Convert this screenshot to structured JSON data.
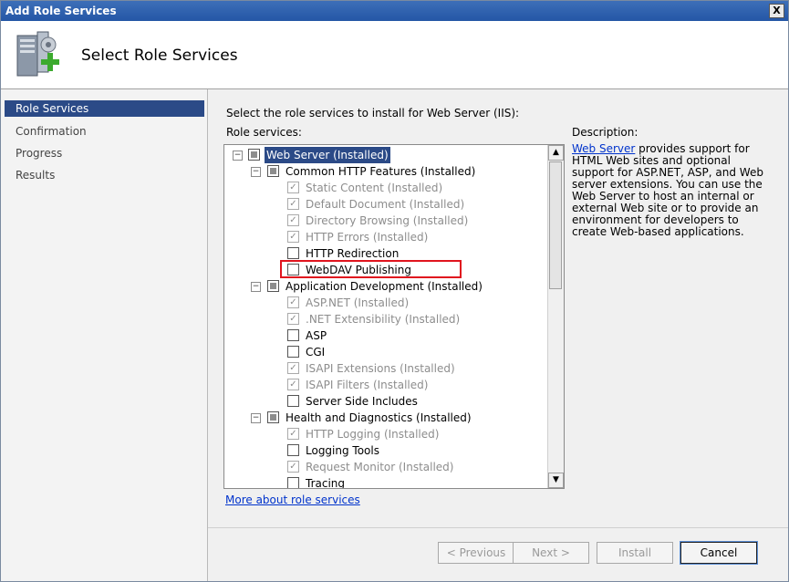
{
  "window": {
    "title": "Add Role Services",
    "close_label": "X"
  },
  "header": {
    "title": "Select Role Services"
  },
  "sidebar": {
    "items": [
      {
        "label": "Role Services",
        "selected": true
      },
      {
        "label": "Confirmation"
      },
      {
        "label": "Progress"
      },
      {
        "label": "Results"
      }
    ]
  },
  "main": {
    "instruction": "Select the role services to install for Web Server (IIS):",
    "role_services_label": "Role services:",
    "description_title": "Description:",
    "description_link": "Web Server",
    "description_text": " provides support for HTML Web sites and optional support for ASP.NET, ASP, and Web server extensions. You can use the Web Server to host an internal or external Web site or to provide an environment for developers to create Web-based applications.",
    "more_link": "More about role services"
  },
  "tree": {
    "items": [
      {
        "label": "Web Server  (Installed)"
      },
      {
        "label": "Common HTTP Features  (Installed)"
      },
      {
        "label": "Static Content  (Installed)"
      },
      {
        "label": "Default Document  (Installed)"
      },
      {
        "label": "Directory Browsing  (Installed)"
      },
      {
        "label": "HTTP Errors  (Installed)"
      },
      {
        "label": "HTTP Redirection"
      },
      {
        "label": "WebDAV Publishing"
      },
      {
        "label": "Application Development  (Installed)"
      },
      {
        "label": "ASP.NET  (Installed)"
      },
      {
        "label": ".NET Extensibility  (Installed)"
      },
      {
        "label": "ASP"
      },
      {
        "label": "CGI"
      },
      {
        "label": "ISAPI Extensions  (Installed)"
      },
      {
        "label": "ISAPI Filters  (Installed)"
      },
      {
        "label": "Server Side Includes"
      },
      {
        "label": "Health and Diagnostics  (Installed)"
      },
      {
        "label": "HTTP Logging  (Installed)"
      },
      {
        "label": "Logging Tools"
      },
      {
        "label": "Request Monitor  (Installed)"
      },
      {
        "label": "Tracing"
      }
    ]
  },
  "buttons": {
    "previous": "< Previous",
    "next": "Next >",
    "install": "Install",
    "cancel": "Cancel"
  },
  "colors": {
    "titlebar": "#2456a6",
    "selection": "#2b4a87",
    "link": "#0033cc",
    "highlight_border": "#e0141e"
  }
}
